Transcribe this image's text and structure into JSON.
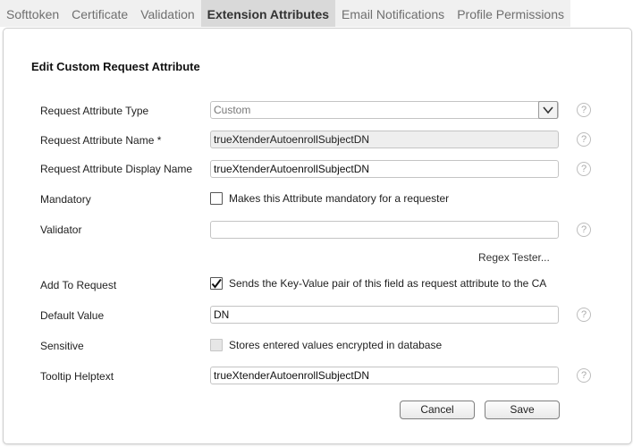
{
  "tabs": [
    {
      "label": "Softtoken",
      "active": false
    },
    {
      "label": "Certificate",
      "active": false
    },
    {
      "label": "Validation",
      "active": false
    },
    {
      "label": "Extension Attributes",
      "active": true
    },
    {
      "label": "Email Notifications",
      "active": false
    },
    {
      "label": "Profile Permissions",
      "active": false
    }
  ],
  "panel": {
    "title": "Edit Custom Request Attribute"
  },
  "form": {
    "type": {
      "label": "Request Attribute Type",
      "value": "Custom"
    },
    "name": {
      "label": "Request Attribute Name *",
      "value": "trueXtenderAutoenrollSubjectDN"
    },
    "display_name": {
      "label": "Request Attribute Display Name",
      "value": "trueXtenderAutoenrollSubjectDN"
    },
    "mandatory": {
      "label": "Mandatory",
      "checkbox_label": "Makes this Attribute mandatory for a requester",
      "checked": false
    },
    "validator": {
      "label": "Validator",
      "value": ""
    },
    "regex_tester": "Regex Tester...",
    "add_to_request": {
      "label": "Add To Request",
      "checkbox_label": "Sends the Key-Value pair of this field as request attribute to the CA",
      "checked": true
    },
    "default_value": {
      "label": "Default Value",
      "value": "DN"
    },
    "sensitive": {
      "label": "Sensitive",
      "checkbox_label": "Stores entered values encrypted in database",
      "checked": false,
      "disabled": true
    },
    "tooltip": {
      "label": "Tooltip Helptext",
      "value": "trueXtenderAutoenrollSubjectDN"
    }
  },
  "help_symbol": "?",
  "buttons": {
    "cancel": "Cancel",
    "save": "Save"
  }
}
